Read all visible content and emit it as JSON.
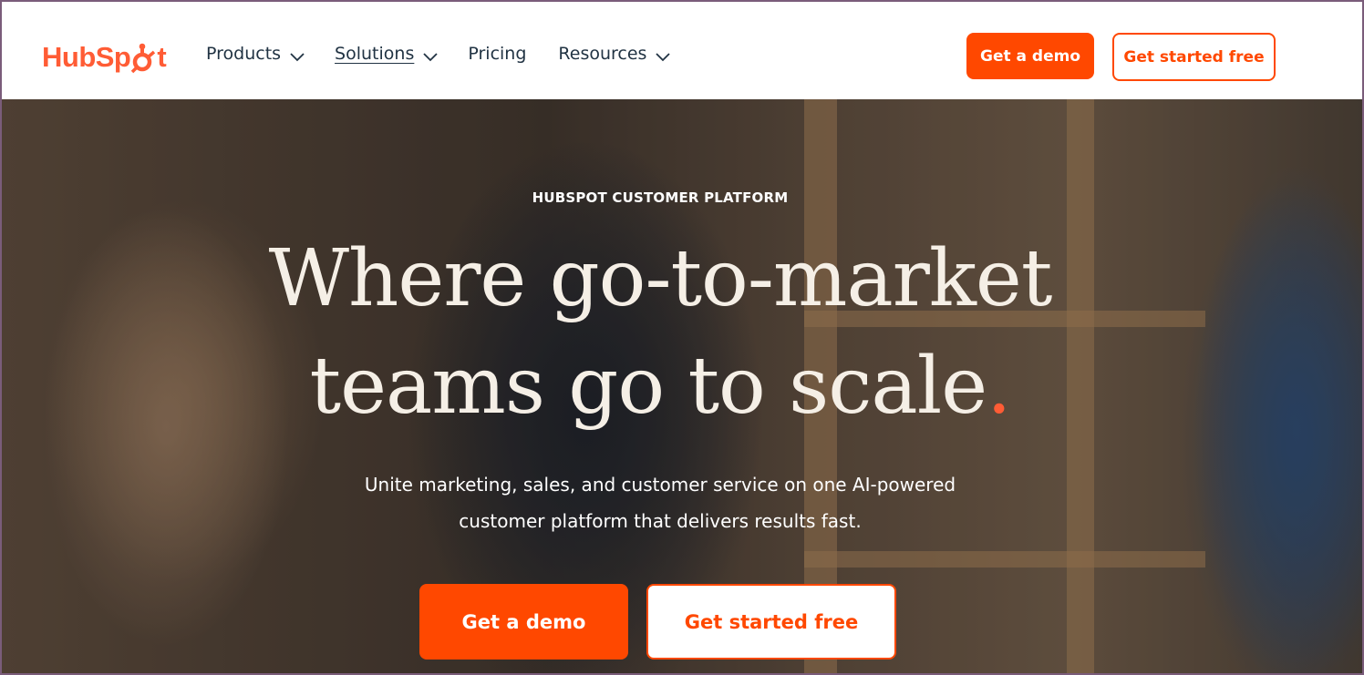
{
  "header": {
    "logo_text": "HubSpot",
    "nav": [
      {
        "label": "Products",
        "has_dropdown": true
      },
      {
        "label": "Solutions",
        "has_dropdown": true
      },
      {
        "label": "Pricing",
        "has_dropdown": false
      },
      {
        "label": "Resources",
        "has_dropdown": true
      }
    ],
    "demo_button": "Get a demo",
    "free_button": "Get started free"
  },
  "hero": {
    "eyebrow": "HUBSPOT CUSTOMER PLATFORM",
    "headline_line1": "Where go-to-market",
    "headline_line2": "teams go to scale",
    "headline_dot": ".",
    "subtext_line1": "Unite marketing, sales, and customer service on one AI-powered",
    "subtext_line2": "customer platform that delivers results fast.",
    "demo_button": "Get a demo",
    "free_button": "Get started free"
  },
  "colors": {
    "brand_orange": "#ff4800",
    "logo_orange": "#ff5c35",
    "nav_text": "#213343",
    "headline_text": "#f5efe6"
  },
  "icons": {
    "dropdown": "chevron-down-icon",
    "logo": "sprocket-icon"
  }
}
